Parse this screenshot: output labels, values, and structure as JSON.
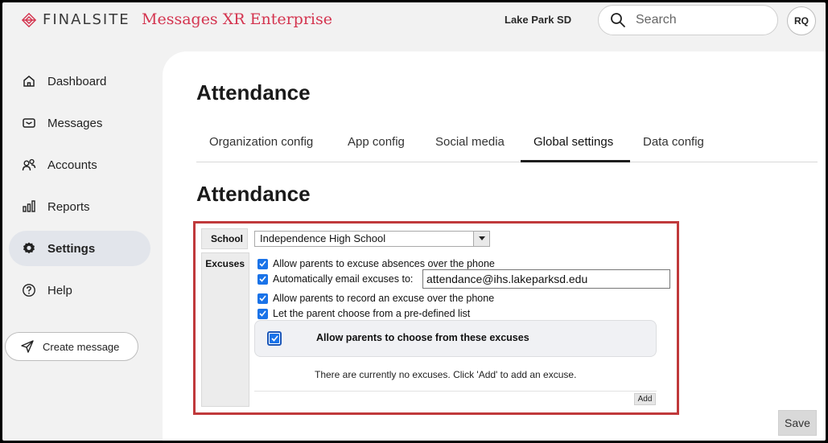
{
  "header": {
    "logo_text": "FINALSITE",
    "product": "Messages XR Enterprise",
    "org": "Lake Park SD",
    "search_placeholder": "Search",
    "avatar_initials": "RQ",
    "brand_color": "#d4344f"
  },
  "sidebar": {
    "items": [
      {
        "label": "Dashboard",
        "icon": "home-icon"
      },
      {
        "label": "Messages",
        "icon": "envelope-icon"
      },
      {
        "label": "Accounts",
        "icon": "users-icon"
      },
      {
        "label": "Reports",
        "icon": "bar-chart-icon"
      },
      {
        "label": "Settings",
        "icon": "gear-icon",
        "active": true
      },
      {
        "label": "Help",
        "icon": "help-icon"
      }
    ],
    "create_message": "Create message"
  },
  "main": {
    "title": "Attendance",
    "tabs": [
      {
        "label": "Organization config"
      },
      {
        "label": "App config"
      },
      {
        "label": "Social media"
      },
      {
        "label": "Global settings",
        "active": true
      },
      {
        "label": "Data config"
      }
    ],
    "section_title": "Attendance"
  },
  "form": {
    "school_label": "School",
    "school_value": "Independence High School",
    "excuses_label": "Excuses",
    "options": [
      "Allow parents to excuse absences over the phone",
      "Automatically email excuses to:",
      "Allow parents to record an excuse over the phone",
      "Let the parent choose from a pre-defined list"
    ],
    "email_value": "attendance@ihs.lakeparksd.edu",
    "choose_label": "Allow parents to choose from these excuses",
    "empty_message": "There are currently no excuses. Click 'Add' to add an excuse.",
    "add_label": "Add",
    "highlight_color": "#c0393b"
  },
  "save_label": "Save"
}
